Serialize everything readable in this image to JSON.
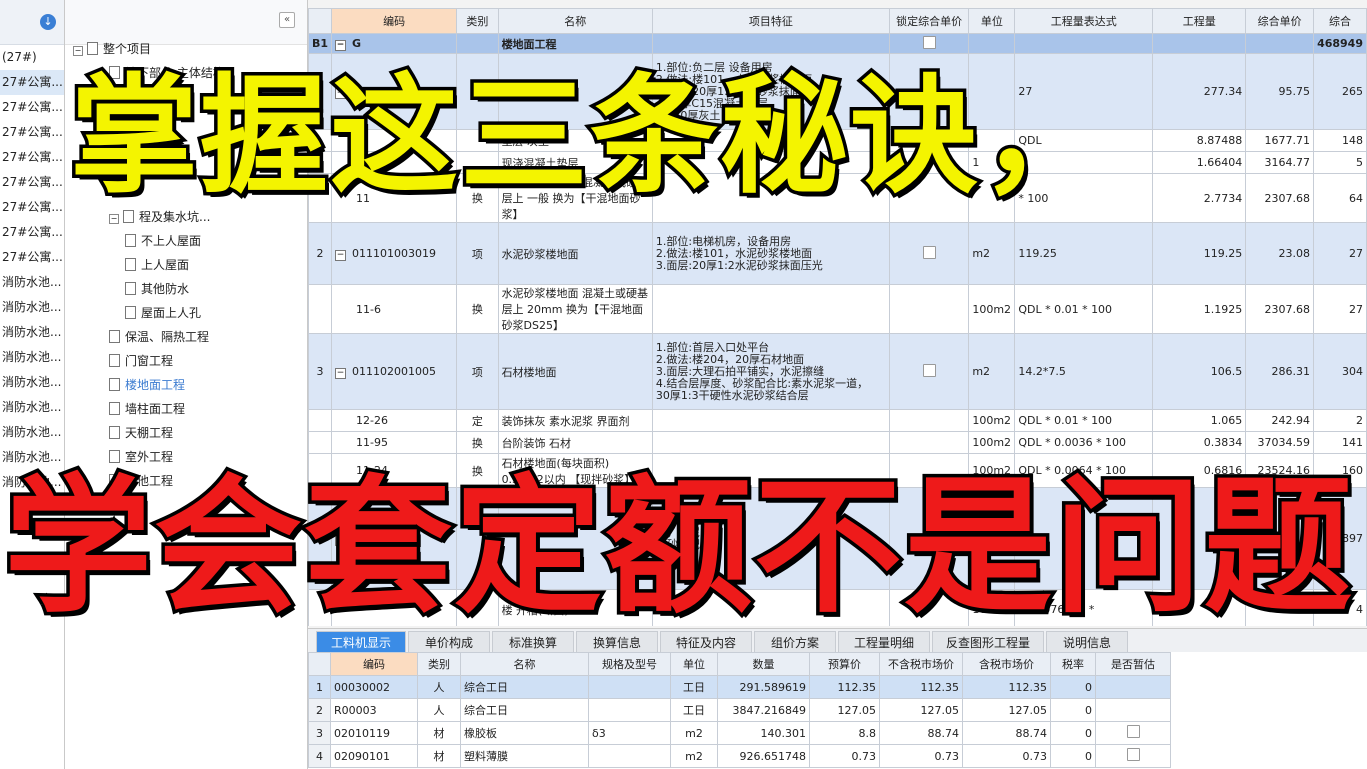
{
  "left_projects": [
    "(27#)",
    "27#公寓...",
    "27#公寓...",
    "27#公寓...",
    "27#公寓...",
    "27#公寓...",
    "27#公寓...",
    "27#公寓...",
    "27#公寓...",
    "消防水池...",
    "消防水池...",
    "消防水池...",
    "消防水池...",
    "消防水池...",
    "消防水池...",
    "消防水池...",
    "消防水池...",
    "消防水池..."
  ],
  "tree": {
    "collapse": "«",
    "root": "整个项目",
    "nodes": [
      {
        "label": "地下部分 主体结构",
        "level": 1
      },
      {
        "label": "",
        "level": 1
      },
      {
        "label": "结构",
        "level": 1
      },
      {
        "label": "体结构",
        "level": 1
      },
      {
        "label": "结构",
        "level": 1
      },
      {
        "label": "程及集水坑...",
        "level": 1
      },
      {
        "label": "不上人屋面",
        "level": 2
      },
      {
        "label": "上人屋面",
        "level": 2
      },
      {
        "label": "其他防水",
        "level": 2
      },
      {
        "label": "屋面上人孔",
        "level": 2
      },
      {
        "label": "保温、隔热工程",
        "level": 1
      },
      {
        "label": "门窗工程",
        "level": 1
      },
      {
        "label": "楼地面工程",
        "level": 1,
        "selected": true
      },
      {
        "label": "墙柱面工程",
        "level": 1
      },
      {
        "label": "天棚工程",
        "level": 1
      },
      {
        "label": "室外工程",
        "level": 1
      },
      {
        "label": "其他工程",
        "level": 1
      }
    ]
  },
  "grid": {
    "headers": [
      "",
      "编码",
      "类别",
      "名称",
      "项目特征",
      "锁定综合单价",
      "单位",
      "工程量表达式",
      "工程量",
      "综合单价",
      "综合"
    ],
    "rows": [
      {
        "type": "fenbu",
        "idx": "B1",
        "code": "G",
        "cat": "",
        "name": "楼地面工程",
        "feat": "",
        "unit": "",
        "expr": "",
        "qty": "",
        "price": "",
        "total": "468949",
        "lock": true
      },
      {
        "type": "qd",
        "idx": "",
        "code": "011101003021",
        "cat": "项",
        "name": "水泥砂浆楼地面",
        "feat": "1.部位:负二层 设备用房\n2.做法:楼101，水泥砂浆楼地面\n3.面层:20厚1:2水泥砂浆抹面压光\n4.60厚C15混凝土垫层\n5.320厚灰土",
        "unit": "",
        "expr": "27",
        "qty": "277.34",
        "price": "95.75",
        "total": "265",
        "lock": true
      },
      {
        "type": "de",
        "idx": "",
        "code": "4-",
        "cat": "",
        "name": "垫层 灰土",
        "feat": "",
        "unit": "",
        "expr": "QDL",
        "qty": "8.87488",
        "price": "1677.71",
        "total": "148"
      },
      {
        "type": "de",
        "idx": "",
        "code": "5-1",
        "cat": "",
        "name": "现浇混凝土垫层",
        "feat": "",
        "unit": "1",
        "expr": "",
        "qty": "1.66404",
        "price": "3164.77",
        "total": "5"
      },
      {
        "type": "de",
        "idx": "",
        "code": "11",
        "cat": "换",
        "name": "水泥砂浆楼地面 混凝土或硬基层上 一般 换为【干混地面砂浆】",
        "feat": "",
        "unit": "",
        "expr": "* 100",
        "qty": "2.7734",
        "price": "2307.68",
        "total": "64"
      },
      {
        "type": "qd",
        "idx": "2",
        "code": "011101003019",
        "cat": "项",
        "name": "水泥砂浆楼地面",
        "feat": "1.部位:电梯机房，设备用房\n2.做法:楼101，水泥砂浆楼地面\n3.面层:20厚1:2水泥砂浆抹面压光",
        "unit": "m2",
        "expr": "119.25",
        "qty": "119.25",
        "price": "23.08",
        "total": "27",
        "lock": true
      },
      {
        "type": "de",
        "idx": "",
        "code": "11-6",
        "cat": "换",
        "name": "水泥砂浆楼地面 混凝土或硬基层上 20mm 换为【干混地面砂浆DS25】",
        "feat": "",
        "unit": "100m2",
        "expr": "QDL * 0.01 * 100",
        "qty": "1.1925",
        "price": "2307.68",
        "total": "27"
      },
      {
        "type": "qd",
        "idx": "3",
        "code": "011102001005",
        "cat": "项",
        "name": "石材楼地面",
        "feat": "1.部位:首层入口处平台\n2.做法:楼204，20厚石材地面\n3.面层:大理石拍平铺实，水泥擦缝\n4.结合层厚度、砂浆配合比:素水泥浆一道，\n30厚1:3干硬性水泥砂浆结合层",
        "unit": "m2",
        "expr": "14.2*7.5",
        "qty": "106.5",
        "price": "286.31",
        "total": "304",
        "lock": true
      },
      {
        "type": "de",
        "idx": "",
        "code": "12-26",
        "cat": "定",
        "name": "装饰抹灰 素水泥浆 界面剂",
        "feat": "",
        "unit": "100m2",
        "expr": "QDL * 0.01 * 100",
        "qty": "1.065",
        "price": "242.94",
        "total": "2"
      },
      {
        "type": "de",
        "idx": "",
        "code": "11-95",
        "cat": "换",
        "name": "台阶装饰 石材",
        "feat": "",
        "unit": "100m2",
        "expr": "QDL * 0.0036 * 100",
        "qty": "0.3834",
        "price": "37034.59",
        "total": "141"
      },
      {
        "type": "de",
        "idx": "",
        "code": "11-24",
        "cat": "换",
        "name": "石材楼地面(每块面积) 0.36m2以内 【现拌砂浆】",
        "feat": "",
        "unit": "100m2",
        "expr": "QDL * 0.0064 * 100",
        "qty": "0.6816",
        "price": "23524.16",
        "total": "160"
      },
      {
        "type": "qd",
        "idx": "",
        "code": "",
        "cat": "",
        "name": "",
        "feat": "，20厚花岗石\n实，水泥\n、砂浆配合\n层",
        "unit": "",
        "expr": "6.5*",
        "qty": "",
        "price": "",
        "total": "2897"
      },
      {
        "type": "de",
        "idx": "",
        "code": "",
        "cat": "",
        "name": "楼 开槽(断面)",
        "feat": "",
        "unit": "100",
        "expr": "DL 0076599 *",
        "qty": "",
        "price": "",
        "total": "4"
      }
    ]
  },
  "tabs": [
    "工料机显示",
    "单价构成",
    "标准换算",
    "换算信息",
    "特征及内容",
    "组价方案",
    "工程量明细",
    "反查图形工程量",
    "说明信息"
  ],
  "bottom": {
    "headers": [
      "",
      "编码",
      "类别",
      "名称",
      "规格及型号",
      "单位",
      "数量",
      "预算价",
      "不含税市场价",
      "含税市场价",
      "税率",
      "是否暂估"
    ],
    "rows": [
      {
        "idx": "1",
        "code": "00030002",
        "cat": "人",
        "name": "综合工日",
        "spec": "",
        "unit": "工日",
        "qty": "291.589619",
        "budget": "112.35",
        "mkt": "112.35",
        "mkt_tax": "112.35",
        "tax": "0",
        "est": false
      },
      {
        "idx": "2",
        "code": "R00003",
        "cat": "人",
        "name": "综合工日",
        "spec": "",
        "unit": "工日",
        "qty": "3847.216849",
        "budget": "127.05",
        "mkt": "127.05",
        "mkt_tax": "127.05",
        "tax": "0",
        "est": false
      },
      {
        "idx": "3",
        "code": "02010119",
        "cat": "材",
        "name": "橡胶板",
        "spec": "δ3",
        "unit": "m2",
        "qty": "140.301",
        "budget": "8.8",
        "mkt": "88.74",
        "mkt_tax": "88.74",
        "tax": "0",
        "est": true
      },
      {
        "idx": "4",
        "code": "02090101",
        "cat": "材",
        "name": "塑料薄膜",
        "spec": "",
        "unit": "m2",
        "qty": "926.651748",
        "budget": "0.73",
        "mkt": "0.73",
        "mkt_tax": "0.73",
        "tax": "0",
        "est": true
      }
    ]
  },
  "overlay": {
    "line1": "掌握这三条秘诀，",
    "line2": "学会套定额不是问题"
  }
}
